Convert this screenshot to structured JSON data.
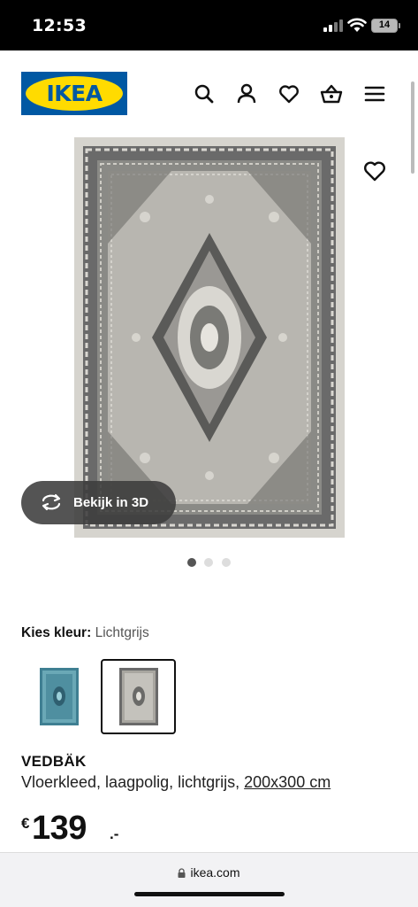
{
  "status": {
    "time": "12:53",
    "battery": "14"
  },
  "header": {
    "logo_text": "IKEA",
    "icons": [
      "search-icon",
      "account-icon",
      "favorites-icon",
      "basket-icon",
      "menu-icon"
    ]
  },
  "gallery": {
    "view_3d_label": "Bekijk in 3D",
    "dot_count": 3,
    "active_dot": 0
  },
  "color_choice": {
    "label": "Kies kleur:",
    "value": "Lichtgrijs",
    "swatches": [
      {
        "color": "blue",
        "selected": false
      },
      {
        "color": "lichtgrijs",
        "selected": true
      }
    ]
  },
  "product": {
    "name": "VEDBÄK",
    "description": "Vloerkleed, laagpolig, lichtgrijs, ",
    "size": "200x300 cm",
    "currency": "€",
    "price_whole": "139",
    "price_decimal": ".-"
  },
  "browser": {
    "url": "ikea.com"
  },
  "colors": {
    "ikea_blue": "#0058a3",
    "ikea_yellow": "#ffdb00",
    "rug_light": "#d8d6d0",
    "rug_dark": "#5e5e5e",
    "swatch_blue": "#4f8fa0"
  }
}
